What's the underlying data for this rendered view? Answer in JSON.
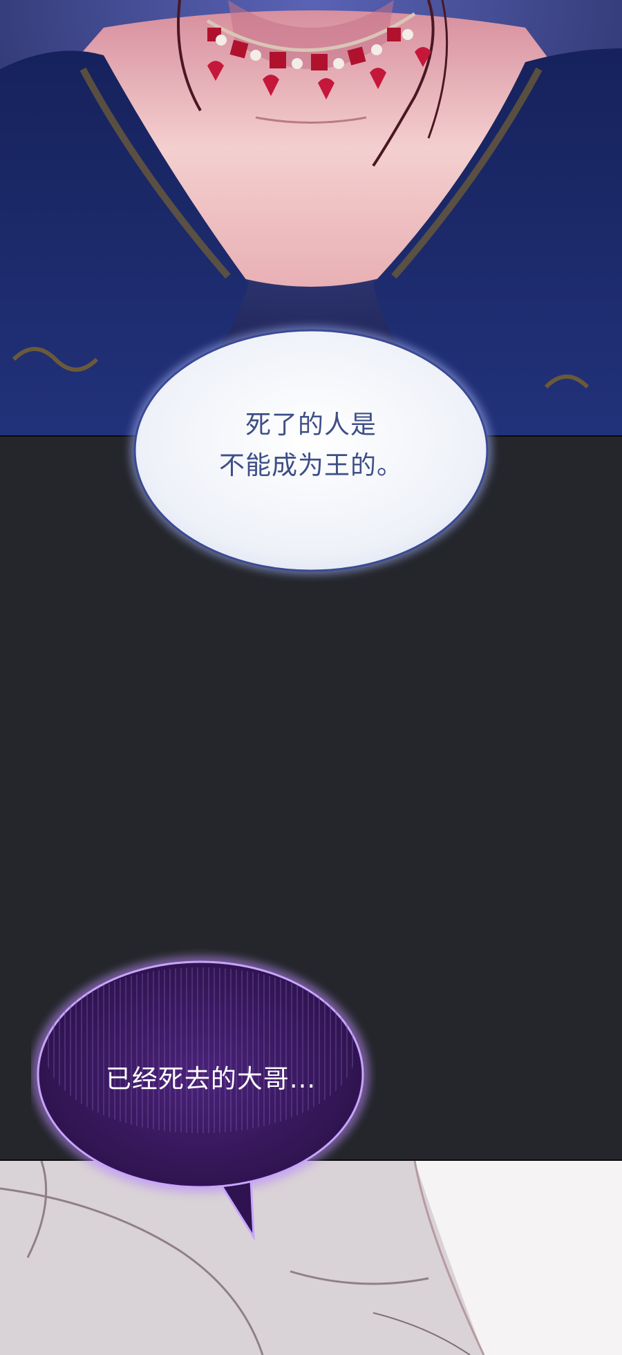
{
  "bubbles": [
    {
      "line1": "死了的人是",
      "line2": "不能成为王的。"
    },
    {
      "text": "已经死去的大哥..."
    }
  ],
  "colors": {
    "dress_navy": "#1d2b6b",
    "dress_embroidery": "#6a5a3a",
    "skin": "#f0c6c6",
    "gem_red": "#b0122e",
    "bubble_white": "#f4f6fb",
    "bubble_outline_blue": "#3a4a95",
    "bubble_purple": "#3b1a63",
    "bubble_outline_purple": "#a97df0",
    "panel_dark": "#24262b"
  }
}
